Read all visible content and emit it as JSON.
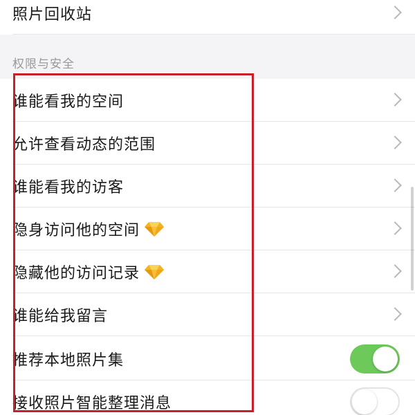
{
  "rows": {
    "photo_recycle": "照片回收站",
    "who_can_view_space": "谁能看我的空间",
    "allow_view_range": "允许查看动态的范围",
    "who_can_view_visitors": "谁能看我的访客",
    "invisible_visit": "隐身访问他的空间",
    "hide_visit_record": "隐藏他的访问记录",
    "who_can_leave_message": "谁能给我留言",
    "recommend_local_photos": "推荐本地照片集",
    "receive_photo_messages": "接收照片智能整理消息"
  },
  "section": {
    "title": "权限与安全"
  },
  "toggles": {
    "recommend_local_photos": "on",
    "receive_photo_messages": "off"
  },
  "colors": {
    "toggle_on": "#6cc95a",
    "highlight": "#c8202a",
    "diamond_gold": "#f5b324"
  },
  "icons": {
    "vip": "yellow-diamond-icon",
    "chevron": "chevron-right-icon"
  }
}
